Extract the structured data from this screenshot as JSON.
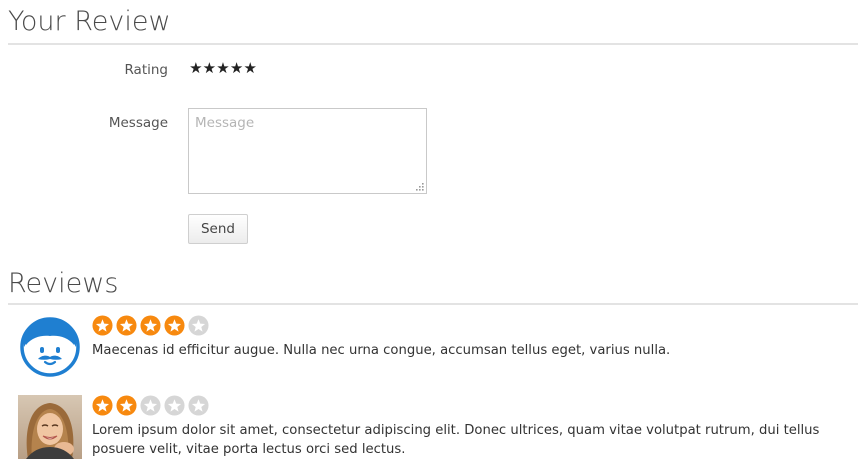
{
  "your_review": {
    "title": "Your Review",
    "rating_label": "Rating",
    "rating_stars": [
      "★",
      "★",
      "★",
      "★",
      "★"
    ],
    "message_label": "Message",
    "message_placeholder": "Message",
    "message_value": "",
    "send_label": "Send"
  },
  "reviews": {
    "title": "Reviews",
    "items": [
      {
        "avatar": "default-user-avatar-icon",
        "rating": 4,
        "max_rating": 5,
        "text": "Maecenas id efficitur augue. Nulla nec urna congue, accumsan tellus eget, varius nulla."
      },
      {
        "avatar": "user-photo",
        "rating": 2,
        "max_rating": 5,
        "text": "Lorem ipsum dolor sit amet, consectetur adipiscing elit. Donec ultrices, quam vitae volutpat rutrum, dui tellus posuere velit, vitae porta lectus orci sed lectus."
      }
    ]
  },
  "colors": {
    "star_filled": "#f7890f",
    "star_empty": "#d6d6d6",
    "avatar_blue": "#1f7fd1",
    "rule": "#e3e3e3"
  }
}
